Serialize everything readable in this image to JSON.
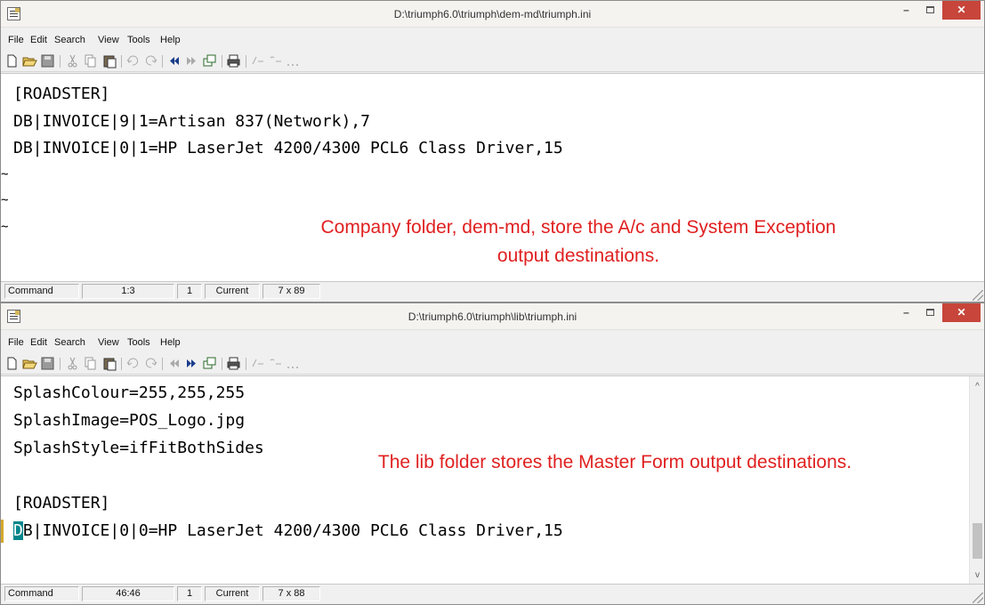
{
  "colors": {
    "annotation": "#e02020",
    "close_button": "#c7453a",
    "cursor": "#00868b",
    "gutter_marker": "#d4a82a"
  },
  "window_buttons": {
    "minimize": "–",
    "maximize": "☐",
    "close": "✕"
  },
  "menu": [
    "File",
    "Edit",
    "Search",
    "View",
    "Tools",
    "Help"
  ],
  "toolbar_icons": [
    "new-file-icon",
    "open-folder-icon",
    "save-disk-icon",
    "cut-scissors-icon",
    "copy-icon",
    "paste-icon",
    "undo-icon",
    "redo-icon",
    "previous-file-icon",
    "next-file-icon",
    "window-icon",
    "print-icon",
    "comment-icon",
    "uncomment-icon",
    "more-icon"
  ],
  "top_window": {
    "title": "D:\\triumph6.0\\triumph\\dem-md\\triumph.ini",
    "lines": [
      "[ROADSTER]",
      "DB|INVOICE|9|1=Artisan 837(Network),7",
      "DB|INVOICE|0|1=HP LaserJet 4200/4300 PCL6 Class Driver,15"
    ],
    "tildes": [
      "~",
      "~",
      "~"
    ],
    "annotation": [
      "Company folder, dem-md, store the A/c and System Exception",
      "output destinations."
    ],
    "status": {
      "mode": "Command",
      "position": "1:3",
      "field3": "1",
      "field4": "Current",
      "size": "7 x 89"
    }
  },
  "bottom_window": {
    "title": "D:\\triumph6.0\\triumph\\lib\\triumph.ini",
    "lines": [
      "SplashColour=255,255,255",
      "SplashImage=POS_Logo.jpg",
      "SplashStyle=ifFitBothSides",
      "",
      "[ROADSTER]"
    ],
    "cursor_line": {
      "cursor_text": "D",
      "rest": "B|INVOICE|0|0=HP LaserJet 4200/4300 PCL6 Class Driver,15"
    },
    "annotation": "The lib folder stores the Master Form output destinations.",
    "scroll": {
      "up": "^",
      "down": "v",
      "position_fraction": 0.95
    },
    "status": {
      "mode": "Command",
      "position": "46:46",
      "field3": "1",
      "field4": "Current",
      "size": "7 x 88"
    }
  }
}
